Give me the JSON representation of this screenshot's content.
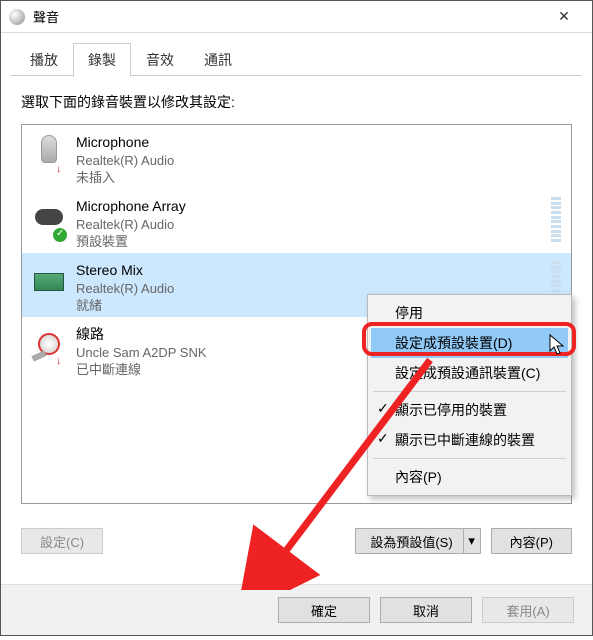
{
  "window": {
    "title": "聲音"
  },
  "tabs": {
    "playback": "播放",
    "recording": "錄製",
    "effects": "音效",
    "comm": "通訊"
  },
  "instruction": "選取下面的錄音裝置以修改其設定:",
  "devices": [
    {
      "name": "Microphone",
      "desc": "Realtek(R) Audio",
      "status": "未插入"
    },
    {
      "name": "Microphone Array",
      "desc": "Realtek(R) Audio",
      "status": "預設裝置"
    },
    {
      "name": "Stereo Mix",
      "desc": "Realtek(R) Audio",
      "status": "就緒"
    },
    {
      "name": "線路",
      "desc": "Uncle Sam A2DP SNK",
      "status": "已中斷連線"
    }
  ],
  "menu": {
    "disable": "停用",
    "set_default": "設定成預設裝置(D)",
    "set_default_comm": "設定成預設通訊裝置(C)",
    "show_disabled": "顯示已停用的裝置",
    "show_disconnected": "顯示已中斷連線的裝置",
    "properties": "內容(P)"
  },
  "buttons": {
    "configure": "設定(C)",
    "set_default": "設為預設值(S)",
    "properties": "內容(P)",
    "ok": "確定",
    "cancel": "取消",
    "apply": "套用(A)"
  }
}
